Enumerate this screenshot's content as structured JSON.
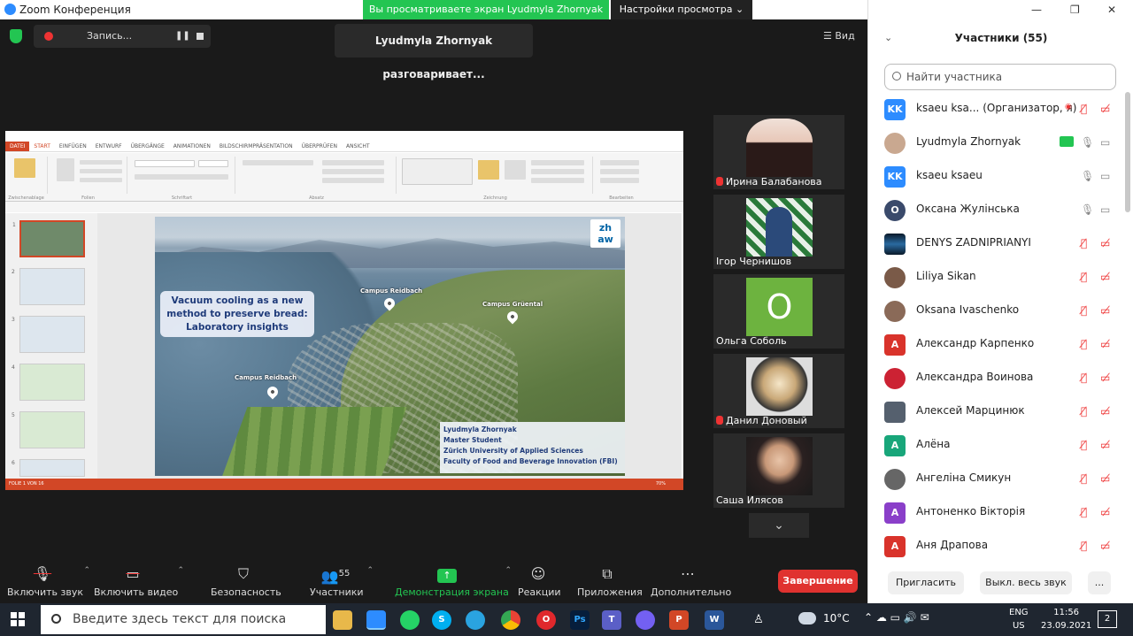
{
  "window": {
    "title": "Zoom Конференция",
    "banner": "Вы просматриваете экран Lyudmyla Zhornyak",
    "view_options": "Настройки просмотра",
    "controls": {
      "minimize": "—",
      "restore": "❐",
      "close": "✕"
    }
  },
  "recording": {
    "label": "Запись...",
    "pause": "❚❚"
  },
  "speaking": "Lyudmyla Zhornyak разговаривает...",
  "view_button": "Вид",
  "slide": {
    "title_lines": [
      "Vacuum cooling as a new",
      "method to preserve bread:",
      "Laboratory insights"
    ],
    "logo_top": "zh",
    "logo_bottom": "aw",
    "campus": [
      "Campus Reidbach",
      "Campus Grüental",
      "Campus Reidbach"
    ],
    "author_lines": [
      "Lyudmyla Zhornyak",
      "Master Student",
      "Zürich University of Applied Sciences",
      "Faculty of Food and Beverage Innovation (FBI)"
    ]
  },
  "ppt": {
    "tabs": [
      "DATEI",
      "START",
      "EINFÜGEN",
      "ENTWURF",
      "ÜBERGÄNGE",
      "ANIMATIONEN",
      "BILDSCHIRMPRÄSENTATION",
      "ÜBERPRÜFEN",
      "ANSICHT"
    ],
    "groups": [
      "Zwischenablage",
      "Folien",
      "Schriftart",
      "Absatz",
      "Zeichnung",
      "Bearbeiten"
    ],
    "status": "FOLIE 1 VON 16",
    "zoom": "70%",
    "thumbs": [
      "1",
      "2",
      "3",
      "4",
      "5",
      "6"
    ]
  },
  "video_tiles": [
    {
      "name": "Ирина Балабанова",
      "muted": true
    },
    {
      "name": "Ігор Чернишов",
      "muted": false
    },
    {
      "name": "Ольга Соболь",
      "muted": false,
      "initial": "О",
      "color": "#6db33f"
    },
    {
      "name": "Данил Доновый",
      "muted": true
    },
    {
      "name": "Саша Илясов",
      "muted": false
    }
  ],
  "toolbar": {
    "mute": "Включить звук",
    "video": "Включить видео",
    "security": "Безопасность",
    "participants": "Участники",
    "participants_count": "55",
    "share": "Демонстрация экрана",
    "reactions": "Реакции",
    "apps": "Приложения",
    "more": "Дополнительно",
    "end": "Завершение"
  },
  "panel": {
    "title": "Участники (55)",
    "search_placeholder": "Найти участника",
    "invite": "Пригласить",
    "mute_all": "Выкл. весь звук",
    "more": "...",
    "participants": [
      {
        "name": "ksaeu ksa...",
        "role": "(Организатор, я)",
        "avatar": "KK",
        "color": "#2D8CFF"
      },
      {
        "name": "Lyudmyla Zhornyak",
        "avatar": "",
        "color": "#c9a890"
      },
      {
        "name": "ksaeu ksaeu",
        "avatar": "KK",
        "color": "#2D8CFF"
      },
      {
        "name": "Оксана Жулінська",
        "avatar": "O",
        "color": "#3a4a6b"
      },
      {
        "name": "DENYS ZADNIPRIANYI",
        "avatar": "",
        "color": "#1b3550"
      },
      {
        "name": "Liliya Sikan",
        "avatar": "",
        "color": "#7a5a48"
      },
      {
        "name": "Oksana Ivaschenko",
        "avatar": "",
        "color": "#8a6a58"
      },
      {
        "name": "Александр Карпенко",
        "avatar": "A",
        "color": "#d9332b"
      },
      {
        "name": "Александра Воинова",
        "avatar": "",
        "color": "#cc2233"
      },
      {
        "name": "Алексей Марцинюк",
        "avatar": "",
        "color": "#55606e"
      },
      {
        "name": "Алёна",
        "avatar": "A",
        "color": "#18a67a"
      },
      {
        "name": "Ангеліна Смикун",
        "avatar": "",
        "color": "#666"
      },
      {
        "name": "Антоненко Вікторія",
        "avatar": "A",
        "color": "#8a3fc9"
      },
      {
        "name": "Аня Драпова",
        "avatar": "A",
        "color": "#d9332b"
      }
    ]
  },
  "taskbar": {
    "search": "Введите здесь текст для поиска",
    "temp": "10°C",
    "lang_top": "ENG",
    "lang_bottom": "US",
    "time": "11:56",
    "date": "23.09.2021",
    "notifications": "2"
  }
}
